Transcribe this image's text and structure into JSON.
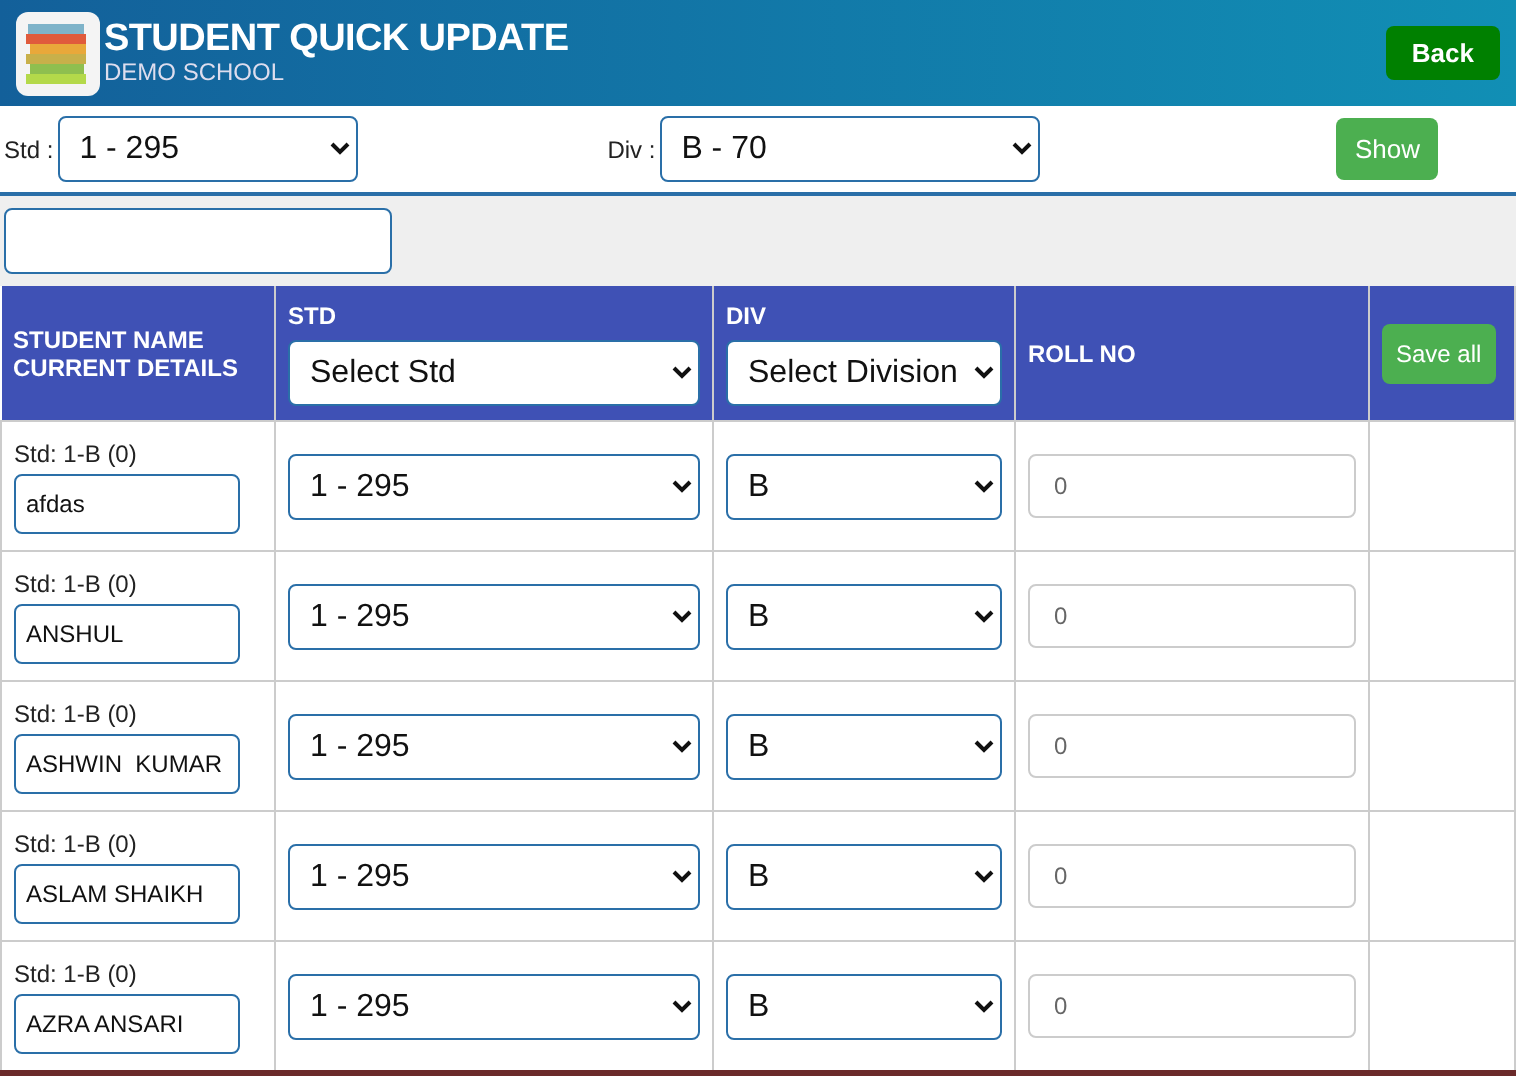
{
  "header": {
    "title": "STUDENT QUICK UPDATE",
    "subtitle": "DEMO SCHOOL",
    "back_button": "Back"
  },
  "filters": {
    "std_label": "Std :",
    "std_value": "1 - 295",
    "div_label": "Div :",
    "div_value": "B - 70",
    "show_button": "Show"
  },
  "table": {
    "columns": [
      {
        "kind": "text",
        "lines": [
          "STUDENT NAME",
          "CURRENT DETAILS"
        ]
      },
      {
        "kind": "select",
        "label": "STD",
        "value": "Select Std"
      },
      {
        "kind": "select",
        "label": "DIV",
        "value": "Select Division"
      },
      {
        "kind": "text",
        "lines": [
          "ROLL NO"
        ]
      },
      {
        "kind": "button",
        "label": "Save all"
      }
    ],
    "rows": [
      {
        "details": "Std: 1-B (0)",
        "name": "afdas",
        "std": "1 - 295",
        "div": "B",
        "roll_no": "0"
      },
      {
        "details": "Std: 1-B (0)",
        "name": "ANSHUL",
        "std": "1 - 295",
        "div": "B",
        "roll_no": "0"
      },
      {
        "details": "Std: 1-B (0)",
        "name": "ASHWIN  KUMAR",
        "std": "1 - 295",
        "div": "B",
        "roll_no": "0"
      },
      {
        "details": "Std: 1-B (0)",
        "name": "ASLAM SHAIKH",
        "std": "1 - 295",
        "div": "B",
        "roll_no": "0"
      },
      {
        "details": "Std: 1-B (0)",
        "name": "AZRA ANSARI",
        "std": "1 - 295",
        "div": "B",
        "roll_no": "0"
      }
    ]
  }
}
